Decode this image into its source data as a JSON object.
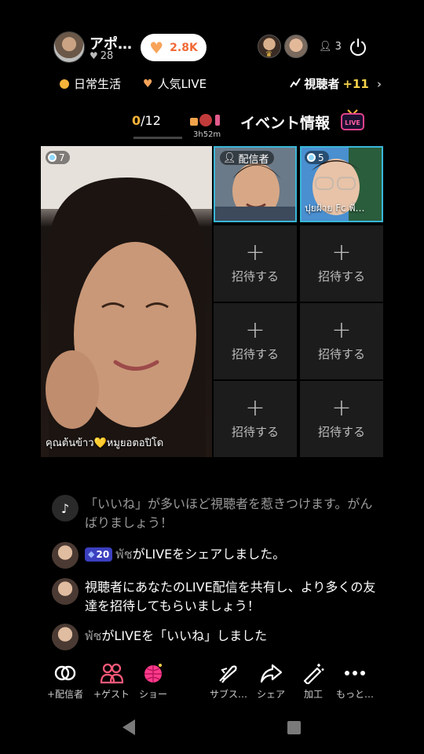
{
  "host": {
    "name": "アポ…",
    "likes": "28"
  },
  "like_pill": {
    "count": "2.8K"
  },
  "viewers": {
    "count": "3"
  },
  "tags": {
    "daily_life": "日常生活",
    "popular_live": "人気LIVE"
  },
  "viewers_link": {
    "label": "視聴者",
    "delta": "+11"
  },
  "event": {
    "progress_done": "0",
    "progress_total": "/12",
    "timer": "3h52m",
    "title": "イベント情報",
    "tv_text": "LIVE"
  },
  "main_guest": {
    "viewer_count": "7",
    "caption": "คุณต้นข้าว💛หมูยอตอปิโด"
  },
  "host_cell": {
    "tag": "配信者"
  },
  "guest_cell": {
    "viewer_count": "5",
    "caption": "ปุยฝ้าย Fc พี่…"
  },
  "empty_slots": {
    "plus": "+",
    "label": "招待する"
  },
  "chat": [
    {
      "text": "「いいね」が多いほど視聴者を惹きつけます。がんばりましょう！"
    },
    {
      "level": "20",
      "user": "พัช",
      "text": "がLIVEをシェアしました。"
    },
    {
      "text": "視聴者にあなたのLIVE配信を共有し、より多くの友達を招待してもらいましょう！"
    },
    {
      "user": "พัช",
      "text": "がLIVEを「いいね」しました"
    }
  ],
  "toolbar": [
    {
      "label": "+配信者",
      "icon": "link-icon"
    },
    {
      "label": "+ゲスト",
      "icon": "guests-icon"
    },
    {
      "label": "ショー",
      "icon": "disco-ball-icon"
    },
    {
      "label": "サブス…",
      "icon": "rocket-icon"
    },
    {
      "label": "シェア",
      "icon": "share-icon"
    },
    {
      "label": "加工",
      "icon": "magic-wand-icon"
    },
    {
      "label": "もっと…",
      "icon": "more-icon"
    }
  ],
  "colors": {
    "accent_orange": "#f06a36",
    "heart_orange": "#f7a45a",
    "gold": "#f6b33a",
    "guest_border": "#3ab6d8",
    "level_badge": "#3b3fbf",
    "show_pink": "#ff3b8a",
    "guest_pink": "#ff5a7a"
  }
}
